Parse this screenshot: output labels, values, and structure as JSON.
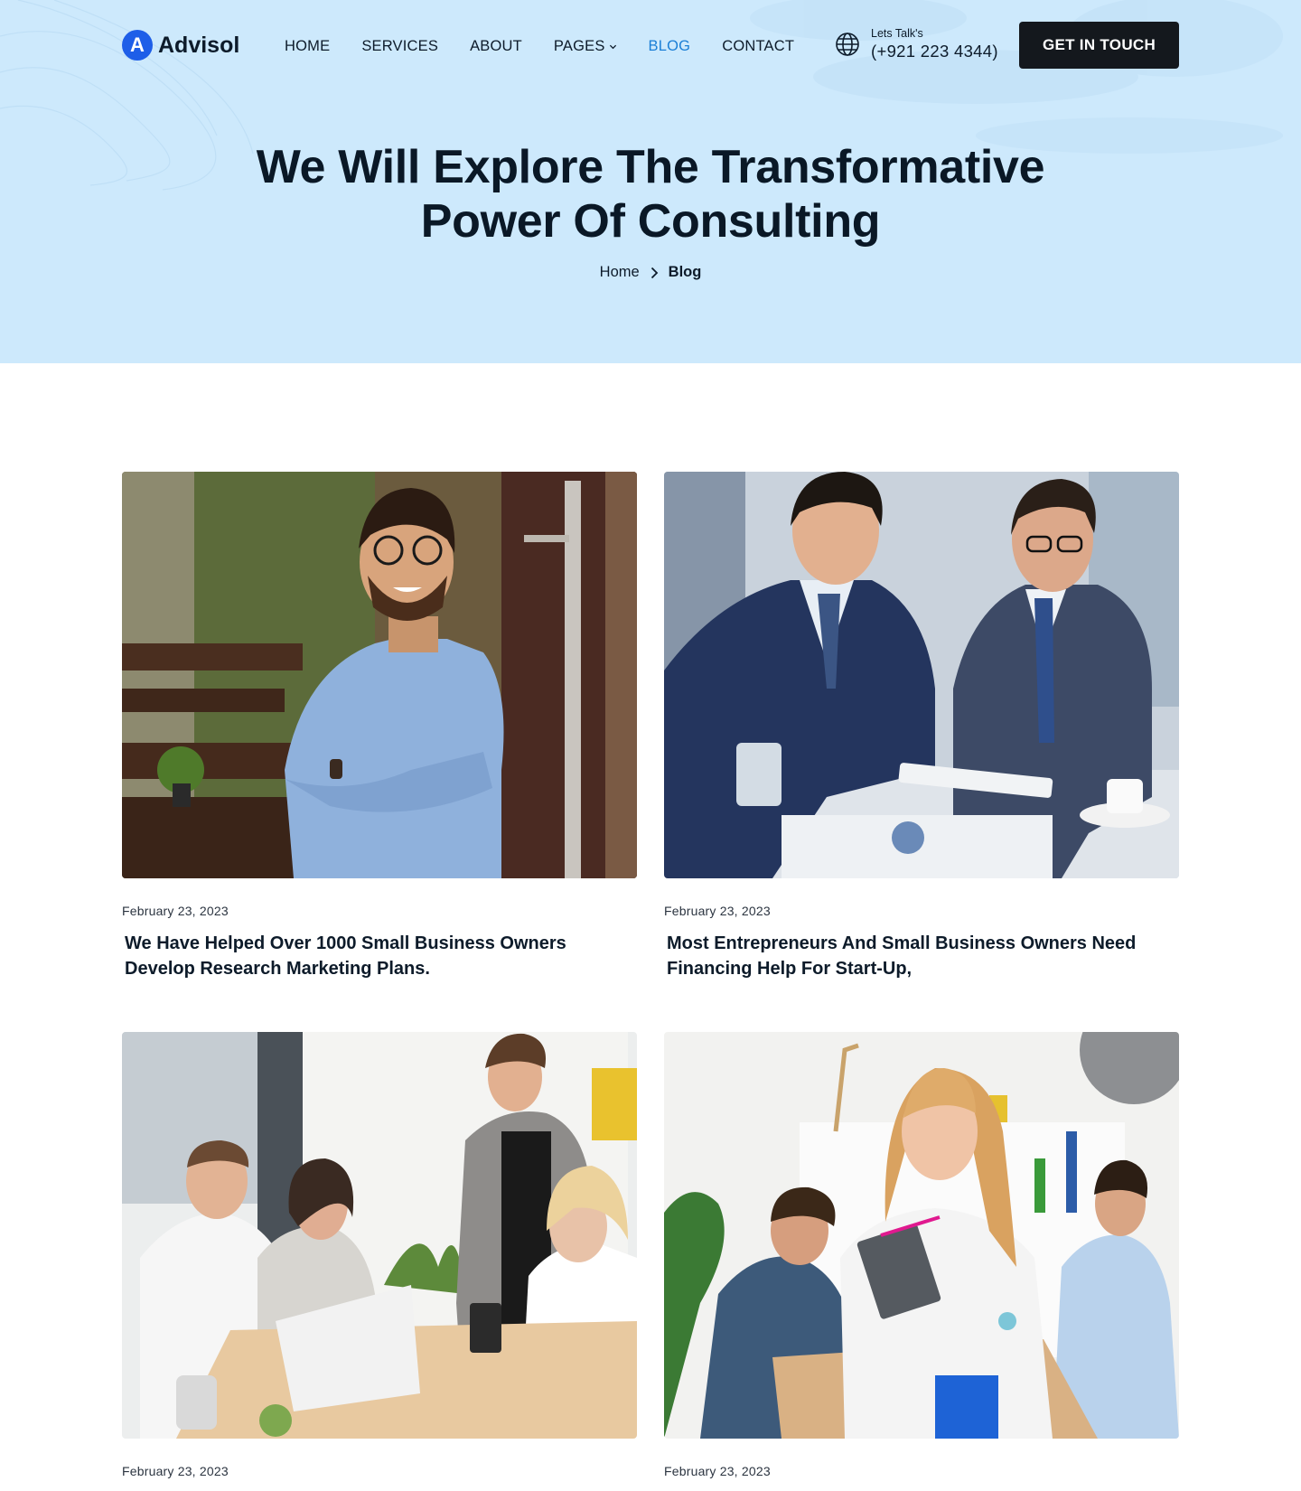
{
  "brand": {
    "logo_letter": "A",
    "name": "Advisol"
  },
  "nav": {
    "items": [
      {
        "label": "HOME",
        "active": false
      },
      {
        "label": "SERVICES",
        "active": false
      },
      {
        "label": "ABOUT",
        "active": false
      },
      {
        "label": "PAGES",
        "active": false,
        "dropdown": true
      },
      {
        "label": "BLOG",
        "active": true
      },
      {
        "label": "CONTACT",
        "active": false
      }
    ]
  },
  "contact": {
    "label": "Lets Talk's",
    "phone": "(+921 223 4344)",
    "icon": "globe-icon"
  },
  "cta": {
    "label": "GET IN TOUCH"
  },
  "hero": {
    "title_line1": "We Will Explore The Transformative",
    "title_line2": "Power Of Consulting"
  },
  "breadcrumb": {
    "home": "Home",
    "current": "Blog"
  },
  "posts": [
    {
      "date": "February 23, 2023",
      "title": "We Have Helped Over 1000 Small Business Owners Develop Research  Marketing Plans.",
      "image": "smiling man in blue shirt at cafe door"
    },
    {
      "date": "February 23, 2023",
      "title": "Most Entrepreneurs And Small Business Owners Need Financing Help For Start-Up,",
      "image": "two businessmen reviewing tablet"
    },
    {
      "date": "February 23, 2023",
      "title": "",
      "image": "team meeting around laptop"
    },
    {
      "date": "February 23, 2023",
      "title": "",
      "image": "woman holding notebook in office"
    }
  ],
  "colors": {
    "hero_bg": "#cde9fc",
    "accent": "#1b7fd6",
    "logo": "#1e5ee8",
    "cta_bg": "#14181d"
  }
}
